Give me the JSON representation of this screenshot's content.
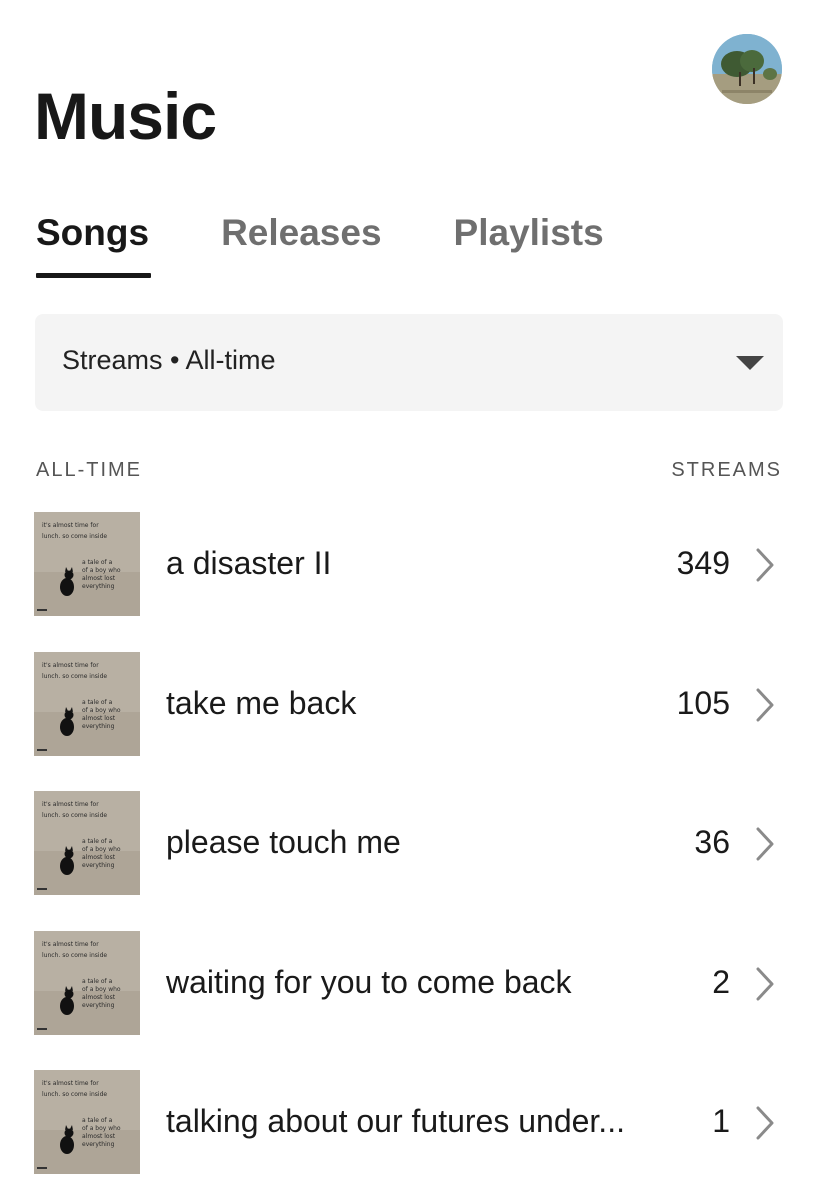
{
  "header": {
    "title": "Music",
    "avatar_icon": "profile-photo-trees"
  },
  "tabs": [
    {
      "label": "Songs",
      "active": true
    },
    {
      "label": "Releases",
      "active": false
    },
    {
      "label": "Playlists",
      "active": false
    }
  ],
  "filter": {
    "selected": "Streams • All-time",
    "caret_icon": "caret-down-icon"
  },
  "list_header": {
    "left": "ALL-TIME",
    "right": "STREAMS"
  },
  "songs": [
    {
      "title": "a disaster II",
      "streams": "349"
    },
    {
      "title": "take me back",
      "streams": "105"
    },
    {
      "title": "please touch me",
      "streams": "36"
    },
    {
      "title": "waiting for you to come back",
      "streams": "2"
    },
    {
      "title": "talking about our futures under...",
      "streams": "1"
    }
  ],
  "artwork": {
    "icon": "album-cover-black-cat",
    "lines": [
      "it's almost time for",
      "lunch. so come inside",
      "a tale of a",
      "of a boy who",
      "almost lost",
      "everything"
    ]
  },
  "colors": {
    "text": "#1a1a1a",
    "tab_inactive": "#6f6f6f",
    "filter_bg": "#f4f4f4",
    "chevron": "#8a8a8a"
  }
}
